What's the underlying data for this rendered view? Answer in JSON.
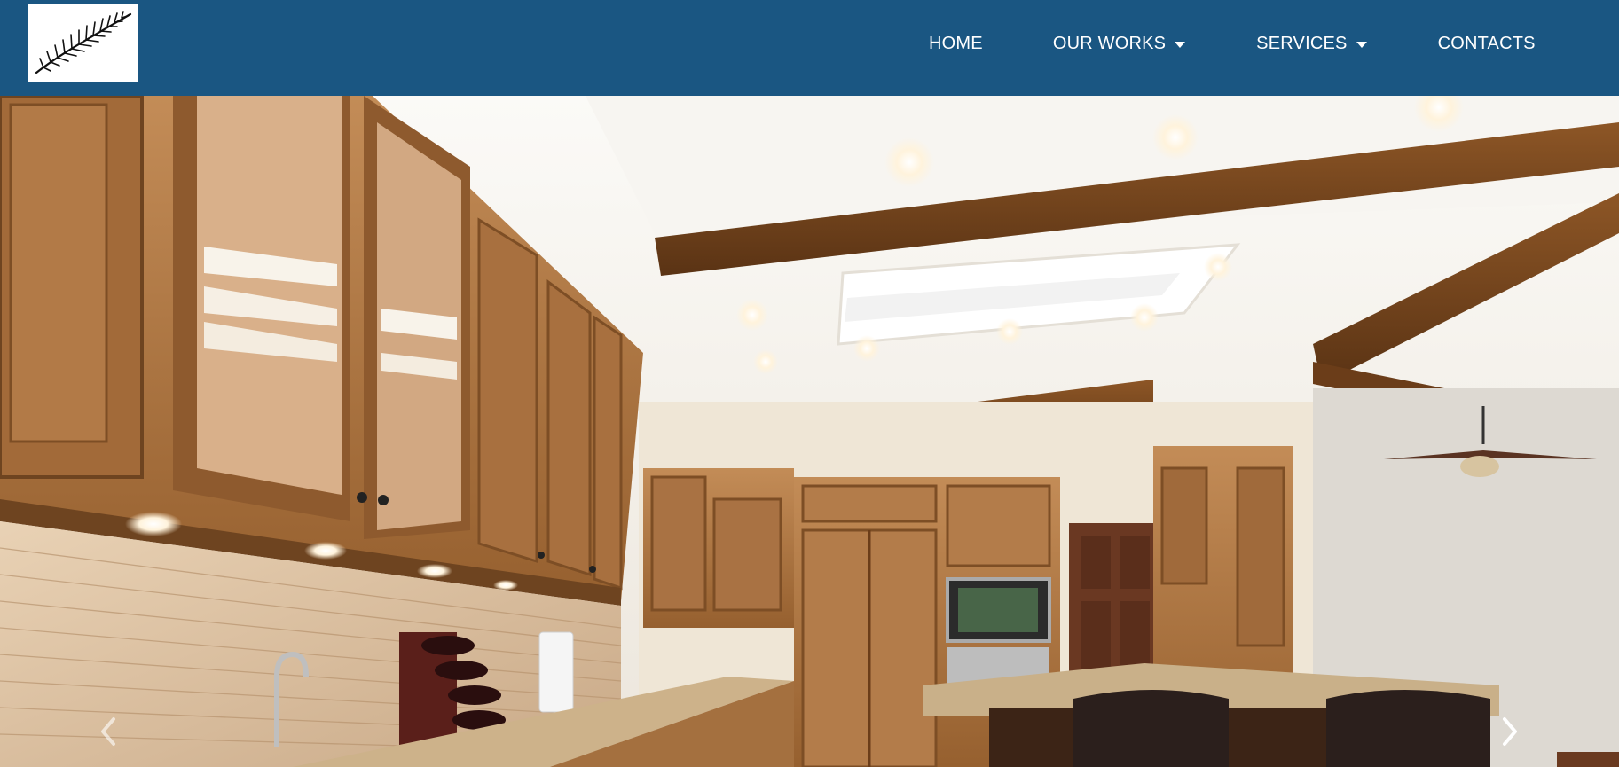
{
  "brand": {
    "logo_icon": "fern-leaf-icon"
  },
  "nav": {
    "items": [
      {
        "label": "HOME",
        "has_dropdown": false
      },
      {
        "label": "OUR WORKS",
        "has_dropdown": true
      },
      {
        "label": "SERVICES",
        "has_dropdown": true
      },
      {
        "label": "CONTACTS",
        "has_dropdown": false
      }
    ]
  },
  "carousel": {
    "prev_icon": "chevron-left-icon",
    "next_icon": "chevron-right-icon"
  },
  "colors": {
    "navbar_bg": "#1a5682",
    "nav_text": "#ffffff",
    "cabinet_wood": "#b07a48",
    "beam_wood": "#7a4a22",
    "ceiling": "#f4f1ec"
  }
}
